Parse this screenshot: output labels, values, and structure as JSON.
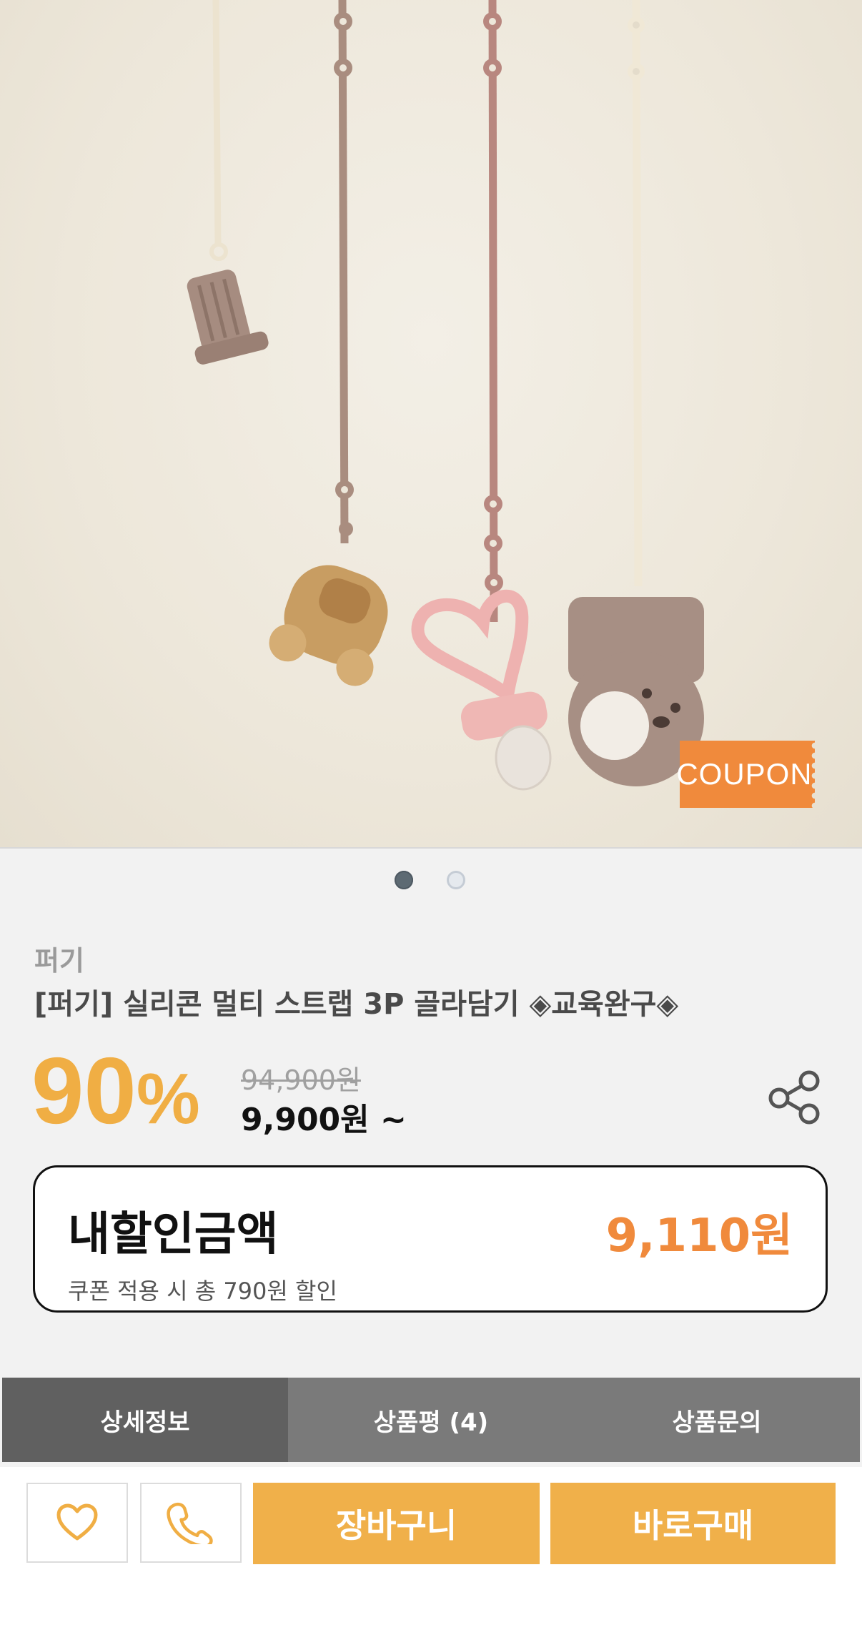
{
  "product_image": {
    "coupon_label": "COUPON",
    "slide_count": 2,
    "active_slide": 1
  },
  "product": {
    "brand": "퍼기",
    "title": "[퍼기] 실리콘 멀티 스트랩 3P 골라담기 ◈교육완구◈"
  },
  "price": {
    "discount_number": "90",
    "discount_symbol": "%",
    "original": "94,900원",
    "sale": "9,900원 ~"
  },
  "my_discount": {
    "label": "내할인금액",
    "amount": "9,110원",
    "note": "쿠폰 적용 시 총 790원 할인"
  },
  "tabs": [
    {
      "label": "상세정보",
      "active": true
    },
    {
      "label": "상품평 (4)",
      "active": false
    },
    {
      "label": "상품문의",
      "active": false
    }
  ],
  "bottom_bar": {
    "cart_label": "장바구니",
    "buy_label": "바로구매"
  },
  "icons": {
    "share": "share-icon",
    "wishlist": "heart-icon",
    "call": "phone-icon"
  },
  "colors": {
    "accent_orange": "#f0ae44",
    "coupon_orange": "#f08a3c",
    "button_yellow": "#f0b04a",
    "tab_active": "#606060",
    "tab_inactive": "#7a7a7a"
  }
}
